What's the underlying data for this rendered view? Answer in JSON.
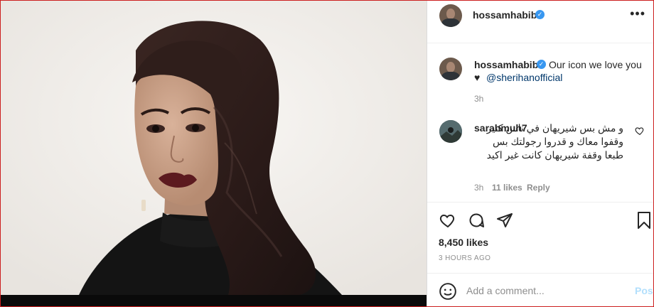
{
  "post": {
    "author": "hossamhabib",
    "caption": {
      "username": "hossamhabib",
      "text": "Our icon we love you",
      "heart": "♥",
      "mention": "@sherihanofficial",
      "age": "3h"
    },
    "comment": {
      "username": "sarahmuh7",
      "text": "و مش بس شيريهان في ناس كتير وقفوا معاك و قدروا رجولتك بس طبعا وقفة شيريهان كانت غير اكيد",
      "age": "3h",
      "likes": "11 likes",
      "reply": "Reply"
    },
    "likes": "8,450 likes",
    "timestamp": "3 HOURS AGO",
    "comment_placeholder": "Add a comment...",
    "post_label": "Post"
  },
  "icons": [
    "more-options-icon",
    "verified-icon",
    "heart-icon",
    "comment-icon",
    "share-icon",
    "bookmark-icon",
    "emoji-icon"
  ],
  "colors": {
    "verified": "#3897f0",
    "mention": "#00376b",
    "muted": "#8e8e8e",
    "post_disabled": "#b2dffc"
  }
}
